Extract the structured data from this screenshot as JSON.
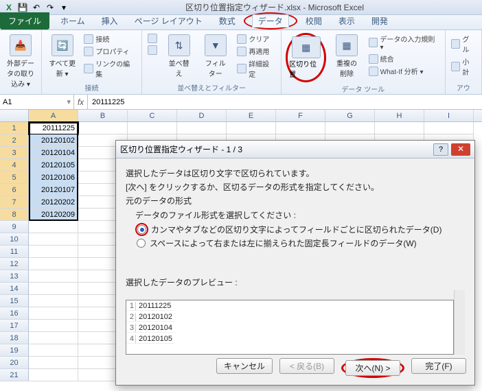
{
  "app": {
    "title": "区切り位置指定ウィザード.xlsx - Microsoft Excel",
    "name_box": "A1",
    "formula": "20111225"
  },
  "qat": {
    "excel": "X",
    "save": "💾",
    "undo": "↶",
    "redo": "↷",
    "dd": "▾"
  },
  "tabs": {
    "file": "ファイル",
    "home": "ホーム",
    "insert": "挿入",
    "pagelayout": "ページ レイアウト",
    "formulas": "数式",
    "data": "データ",
    "review": "校閲",
    "view": "表示",
    "developer": "開発"
  },
  "ribbon": {
    "ext_data": "外部データの取り込み ▾",
    "refresh_all": "すべて更新 ▾",
    "connections": "接続",
    "conn_connect": "接続",
    "conn_props": "プロパティ",
    "conn_edit": "リンクの編集",
    "sort_asc": "A→Z",
    "sort_desc": "Z→A",
    "sort": "並べ替え",
    "filter": "フィルター",
    "clear": "クリア",
    "reapply": "再適用",
    "advanced": "詳細設定",
    "sort_filter_group": "並べ替えとフィルター",
    "text_to_columns": "区切り位置",
    "remove_dup": "重複の削除",
    "data_val": "データの入力規則 ▾",
    "consolidate": "統合",
    "whatif": "What-If 分析 ▾",
    "data_tools": "データ ツール",
    "group": "グル",
    "subtotal": "小計",
    "outline": "アウ"
  },
  "columns": [
    "A",
    "B",
    "C",
    "D",
    "E",
    "F",
    "G",
    "H",
    "I"
  ],
  "rows": [
    "1",
    "2",
    "3",
    "4",
    "5",
    "6",
    "7",
    "8",
    "9",
    "10",
    "11",
    "12",
    "13",
    "14",
    "15",
    "16",
    "17",
    "18",
    "19",
    "20",
    "21"
  ],
  "cell_data": [
    "20111225",
    "20120102",
    "20120104",
    "20120105",
    "20120106",
    "20120107",
    "20120202",
    "20120209"
  ],
  "dialog": {
    "title": "区切り位置指定ウィザード - 1 / 3",
    "line1": "選択したデータは区切り文字で区切られています。",
    "line2": "[次へ] をクリックするか、区切るデータの形式を指定してください。",
    "group1": "元のデータの形式",
    "subgroup": "データのファイル形式を選択してください :",
    "radio1": "カンマやタブなどの区切り文字によってフィールドごとに区切られたデータ(D)",
    "radio2": "スペースによって右または左に揃えられた固定長フィールドのデータ(W)",
    "preview_label": "選択したデータのプレビュー :",
    "preview_rows": [
      {
        "n": "1",
        "v": "20111225"
      },
      {
        "n": "2",
        "v": "20120102"
      },
      {
        "n": "3",
        "v": "20120104"
      },
      {
        "n": "4",
        "v": "20120105"
      }
    ],
    "cancel": "キャンセル",
    "back": "< 戻る(B)",
    "next": "次へ(N) >",
    "finish": "完了(F)"
  }
}
